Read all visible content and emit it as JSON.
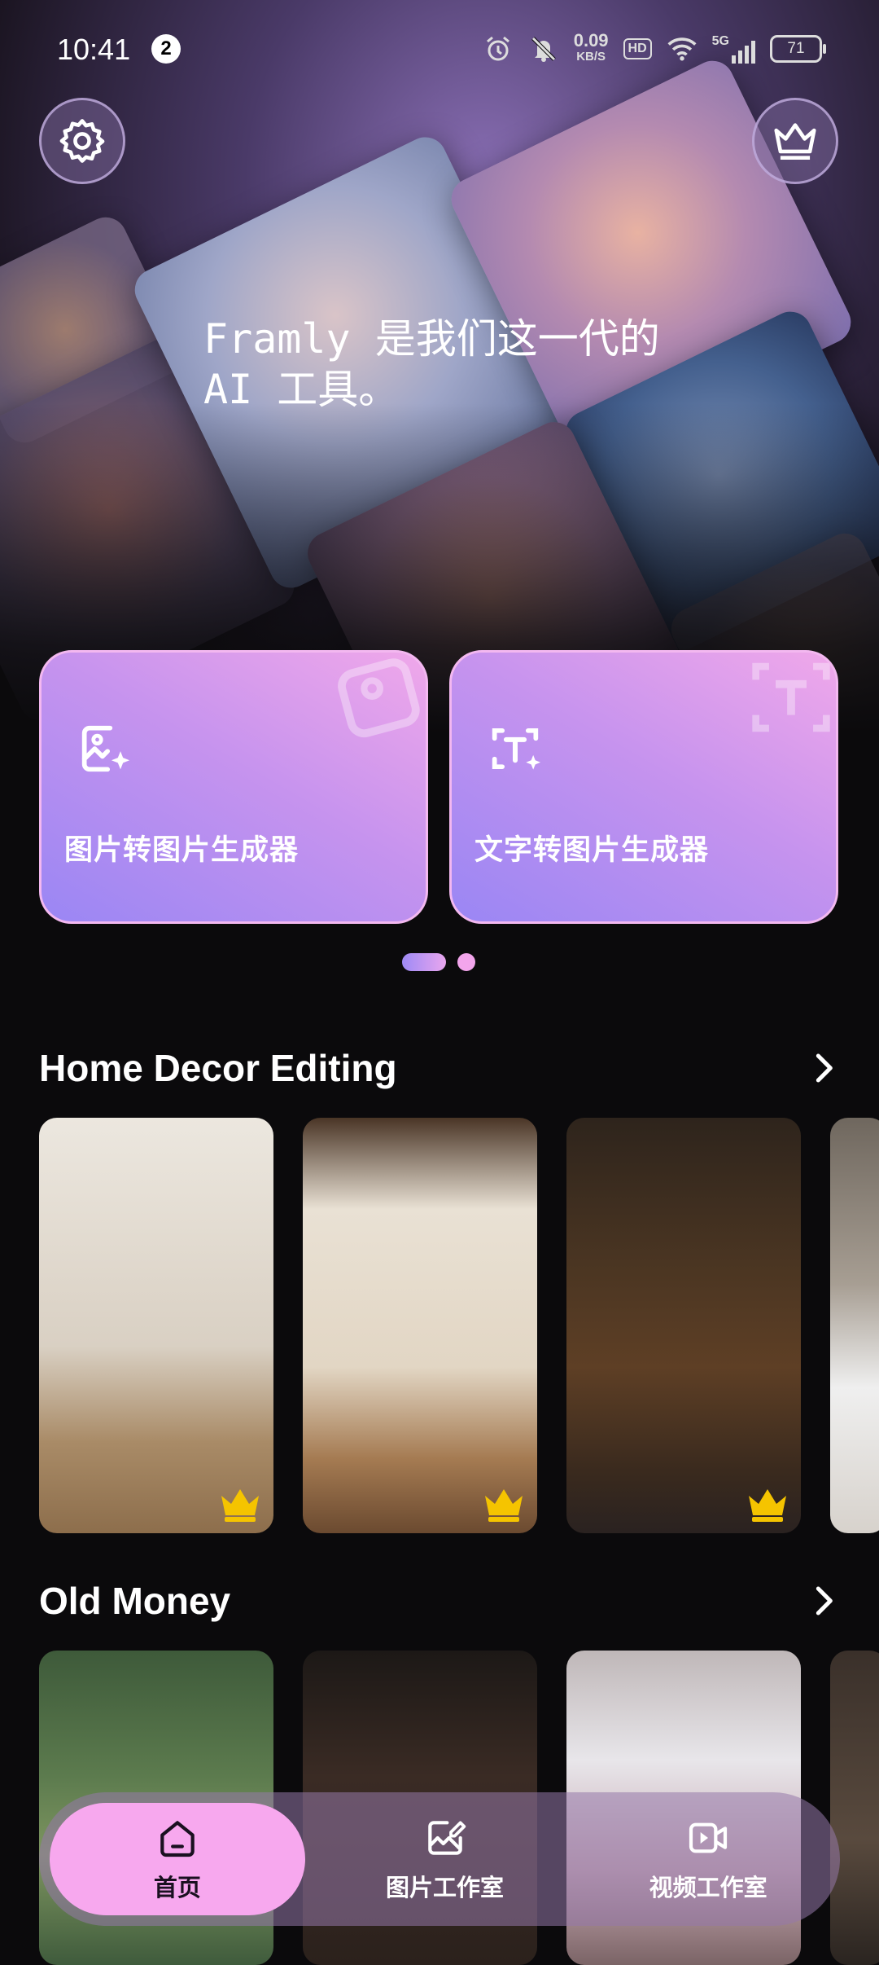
{
  "status_bar": {
    "time": "10:41",
    "notification_count": "2",
    "net_speed_value": "0.09",
    "net_speed_unit": "KB/S",
    "hd_label": "HD",
    "network_label": "5G",
    "battery": "71"
  },
  "hero": {
    "tagline": "Framly 是我们这一代的\nAI 工具。"
  },
  "top_buttons": {
    "settings_icon": "gear-icon",
    "vip_icon": "crown-icon"
  },
  "feature_cards": [
    {
      "label": "图片转图片生成器",
      "icon": "image-sparkle-icon"
    },
    {
      "label": "文字转图片生成器",
      "icon": "text-scan-icon"
    }
  ],
  "carousel": {
    "page_count": 2,
    "active_index": 0
  },
  "sections": [
    {
      "title": "Home Decor Editing",
      "items": [
        {
          "scene": "classic-room",
          "premium": true
        },
        {
          "scene": "mediterranean-living-room",
          "premium": true
        },
        {
          "scene": "library-study",
          "premium": true
        },
        {
          "scene": "bedroom",
          "premium": false
        }
      ]
    },
    {
      "title": "Old Money",
      "items": [
        {
          "scene": "tennis-court",
          "premium": false
        },
        {
          "scene": "library-man",
          "premium": false
        },
        {
          "scene": "window-woman",
          "premium": false
        },
        {
          "scene": "interior",
          "premium": false
        }
      ]
    }
  ],
  "bottom_nav": [
    {
      "label": "首页",
      "icon": "home-icon",
      "active": true
    },
    {
      "label": "图片工作室",
      "icon": "image-edit-icon",
      "active": false
    },
    {
      "label": "视频工作室",
      "icon": "video-edit-icon",
      "active": false
    }
  ],
  "colors": {
    "background": "#0b0a0c",
    "card_gradient_start": "#f0a8ea",
    "card_gradient_end": "#9a86f4",
    "nav_active": "#f7a8ee",
    "crown": "#f5c400"
  }
}
